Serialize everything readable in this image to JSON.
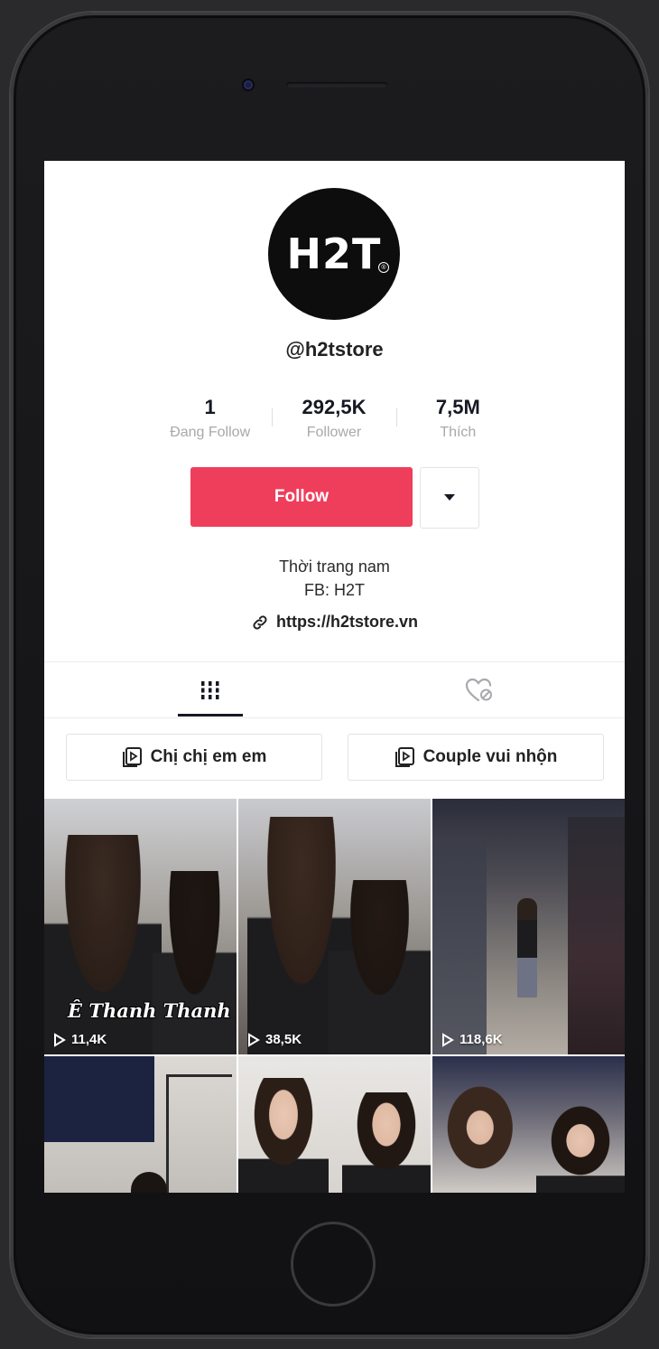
{
  "profile": {
    "avatar_logo_text": "H2T",
    "username": "@h2tstore"
  },
  "stats": [
    {
      "value": "1",
      "label": "Đang Follow"
    },
    {
      "value": "292,5K",
      "label": "Follower"
    },
    {
      "value": "7,5M",
      "label": "Thích"
    }
  ],
  "actions": {
    "follow_label": "Follow"
  },
  "bio": {
    "line1": "Thời trang nam",
    "line2": "FB: H2T",
    "link": "https://h2tstore.vn"
  },
  "tabs": [
    {
      "icon": "grid-icon",
      "active": true
    },
    {
      "icon": "liked-heart-icon",
      "active": false
    }
  ],
  "playlists": [
    {
      "label": "Chị chị em em"
    },
    {
      "label": "Couple vui nhộn"
    }
  ],
  "videos": [
    {
      "views": "11,4K",
      "caption": "Ê Thanh Thanh"
    },
    {
      "views": "38,5K",
      "caption": ""
    },
    {
      "views": "118,6K",
      "caption": ""
    },
    {
      "views": "",
      "caption": ""
    },
    {
      "views": "",
      "caption": ""
    },
    {
      "views": "",
      "caption": ""
    }
  ],
  "colors": {
    "follow_button": "#ee3e5b",
    "text_primary": "#161823",
    "text_secondary": "#a8a8ae"
  }
}
